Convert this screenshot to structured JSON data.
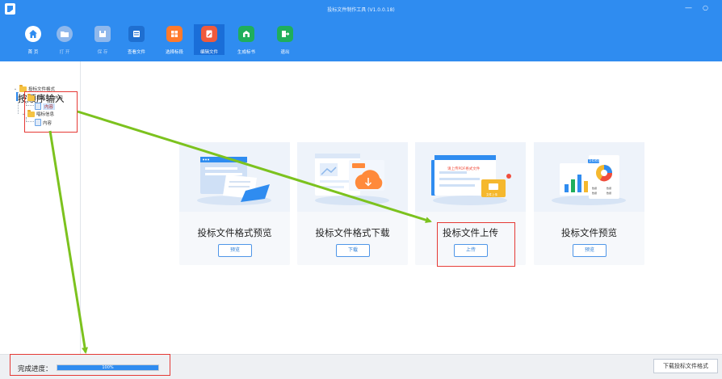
{
  "window": {
    "title": "投标文件制作工具 (V1.0.0.18)",
    "minimize_glyph": "—",
    "close_glyph": "○"
  },
  "toolbar": {
    "items": [
      {
        "label": "首 页",
        "icon": "home-icon",
        "color": "#2f8cf0",
        "enabled": true
      },
      {
        "label": "打 开",
        "icon": "folder-open-icon",
        "color": "#8fb8ec",
        "enabled": false
      },
      {
        "label": "保 存",
        "icon": "save-icon",
        "color": "#8fb8ec",
        "enabled": false
      },
      {
        "label": "查看文件",
        "icon": "view-file-icon",
        "color": "#1f6fd0",
        "enabled": true
      },
      {
        "label": "选择标段",
        "icon": "select-section-icon",
        "color": "#ff7a2b",
        "enabled": true
      },
      {
        "label": "编辑文件",
        "icon": "edit-file-icon",
        "color": "#f05a3c",
        "enabled": true
      },
      {
        "label": "生成标书",
        "icon": "generate-bid-icon",
        "color": "#1fae5b",
        "enabled": true
      },
      {
        "label": "退出",
        "icon": "exit-icon",
        "color": "#1fae5b",
        "enabled": true
      }
    ]
  },
  "tree": {
    "title": "按顺序输入",
    "nodes": [
      {
        "label": "投标文件格式",
        "type": "folder",
        "level": 0,
        "expanded": true
      },
      {
        "label": "投标文件内容",
        "type": "folder",
        "level": 1,
        "expanded": true
      },
      {
        "label": "内容",
        "type": "doc",
        "level": 2,
        "selected": true
      },
      {
        "label": "唱标信息",
        "type": "folder",
        "level": 1,
        "expanded": true
      },
      {
        "label": "内容",
        "type": "doc",
        "level": 2,
        "selected": false
      }
    ]
  },
  "cards": [
    {
      "title": "投标文件格式预览",
      "button": "预览",
      "illustration": "document-preview-illustration"
    },
    {
      "title": "投标文件格式下载",
      "button": "下载",
      "illustration": "cloud-download-illustration"
    },
    {
      "title": "投标文件上传",
      "button": "上传",
      "illustration": "pdf-upload-illustration",
      "badge": "请上传PDF格式文件",
      "folder_label": "文件上传"
    },
    {
      "title": "投标文件预览",
      "button": "预览",
      "illustration": "chart-report-illustration",
      "tag": "文件预览",
      "legend": [
        "数据",
        "数据",
        "数据",
        "数据"
      ]
    }
  ],
  "status": {
    "progress_label": "完成进度：",
    "progress_value": 100,
    "progress_text": "100%",
    "download_format_button": "下载投标文件格式"
  },
  "colors": {
    "accent": "#2f8cf0",
    "annotation_box": "#e53935",
    "annotation_arrow": "#7cc21e"
  }
}
